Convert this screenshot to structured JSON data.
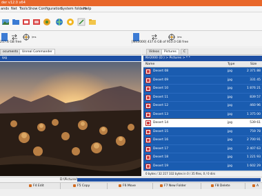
{
  "window": {
    "title": "der v12.0 x64"
  },
  "menu": [
    "ands",
    "Net",
    "Tools",
    "Show",
    "Configuration",
    "Start",
    "Help"
  ],
  "menu_fixed": [
    "ands",
    "Net",
    "Tools",
    "Show",
    "Configuration",
    "System folders",
    "Help"
  ],
  "drives": {
    "left_free": "217.6 GB free",
    "left_label": "\\ms",
    "right_free": "[NV2000] 437.6 GB of 953.0 GB free",
    "right_label": "\\ms"
  },
  "tabs": {
    "left": [
      "ocuments",
      "Unreal Commander"
    ],
    "right": [
      "Videos",
      "Pictures",
      "C"
    ]
  },
  "paths": {
    "left": "ipg",
    "right": "NV2000 (D:) > Pictures > * *"
  },
  "columns": {
    "name": "Name",
    "type": "Type",
    "size": "Size"
  },
  "files": [
    {
      "name": "Desert 08",
      "type": "jpg",
      "size": "2 371 88"
    },
    {
      "name": "Desert 09",
      "type": "jpg",
      "size": "331 45"
    },
    {
      "name": "Desert 10",
      "type": "jpg",
      "size": "1 876 21"
    },
    {
      "name": "Desert 11",
      "type": "jpg",
      "size": "839 57"
    },
    {
      "name": "Desert 12",
      "type": "jpg",
      "size": "460 96"
    },
    {
      "name": "Desert 13",
      "type": "jpg",
      "size": "1 375 00"
    },
    {
      "name": "Desert 14",
      "type": "jpg",
      "size": "539 61",
      "cursor": true
    },
    {
      "name": "Desert 15",
      "type": "jpg",
      "size": "759 78"
    },
    {
      "name": "Desert 16",
      "type": "jpg",
      "size": "2 700 91"
    },
    {
      "name": "Desert 17",
      "type": "jpg",
      "size": "2 407 63"
    },
    {
      "name": "Desert 18",
      "type": "jpg",
      "size": "1 221 93"
    },
    {
      "name": "Desert 19",
      "type": "jpg",
      "size": "1 602 29"
    }
  ],
  "status_right": "0 bytes / 32 217 332 bytes in 0 / 35 files, 0 / 0 dirs",
  "cmdline_path": "D:\\Pictures\\>",
  "fkeys": [
    {
      "label": "F4 Edit"
    },
    {
      "label": "F5 Copy"
    },
    {
      "label": "F6 Move"
    },
    {
      "label": "F7 New Folder"
    },
    {
      "label": "F8 Delete"
    },
    {
      "label": "A"
    }
  ],
  "toolbar_icons": [
    "image-icon",
    "folder-icon",
    "refresh-icon",
    "tree-icon",
    "copy-icon",
    "move-icon",
    "pack-icon",
    "search-icon",
    "settings-icon",
    "compare-icon",
    "open-icon"
  ],
  "accent": "#e8672a",
  "selection": "#1a5cb0"
}
